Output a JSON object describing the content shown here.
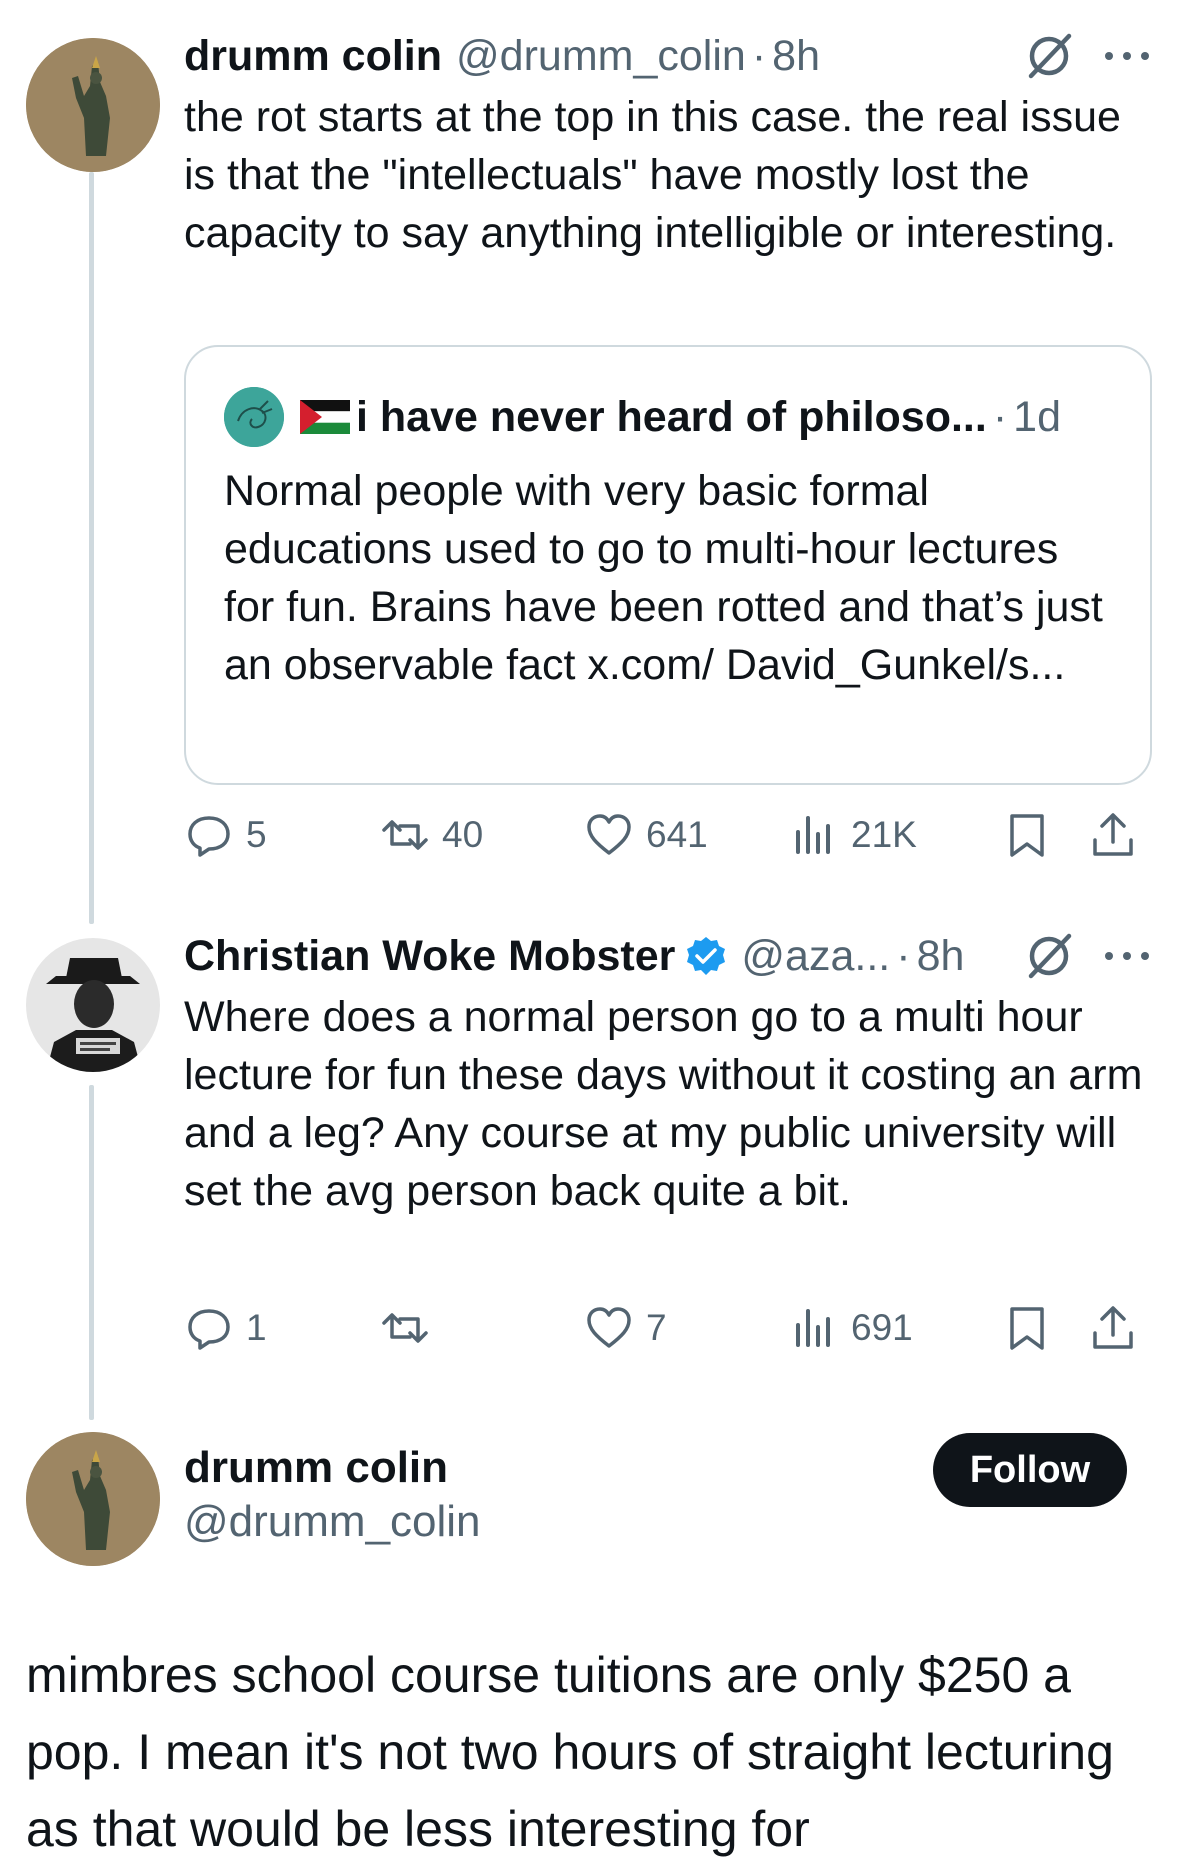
{
  "colors": {
    "text": "#0f1419",
    "secondary": "#536471",
    "border": "#cfd9de",
    "verified": "#1d9bf0",
    "follow_bg": "#0f1419"
  },
  "tweet1": {
    "name": "drumm colin",
    "handle": "@drumm_colin",
    "separator": "·",
    "time": "8h",
    "text": "the rot starts at the top in this case. the real issue is that the \"intellectuals\" have mostly lost the capacity to say anything intelligible or interesting.",
    "quote": {
      "name": "i have never heard of philoso...",
      "separator": "·",
      "time": "1d",
      "text": "Normal people with very basic formal educations used to go to multi-hour lectures for fun. Brains have been rotted and that’s just an observable fact x.com/ David_Gunkel/s..."
    },
    "actions": {
      "replies": "5",
      "reposts": "40",
      "likes": "641",
      "views": "21K"
    }
  },
  "tweet2": {
    "name": "Christian Woke Mobster",
    "handle": "@aza...",
    "separator": "·",
    "time": "8h",
    "text": "Where does a normal person go to a multi hour lecture for fun these days without it costing an arm and a leg? Any course at my public university will set the avg person back quite a bit.",
    "actions": {
      "replies": "1",
      "reposts": "",
      "likes": "7",
      "views": "691"
    }
  },
  "main_tweet": {
    "name": "drumm colin",
    "handle": "@drumm_colin",
    "follow_label": "Follow",
    "text": "mimbres school course tuitions are only $250 a pop. I mean it's not two hours of straight lecturing as that would be less interesting for"
  }
}
